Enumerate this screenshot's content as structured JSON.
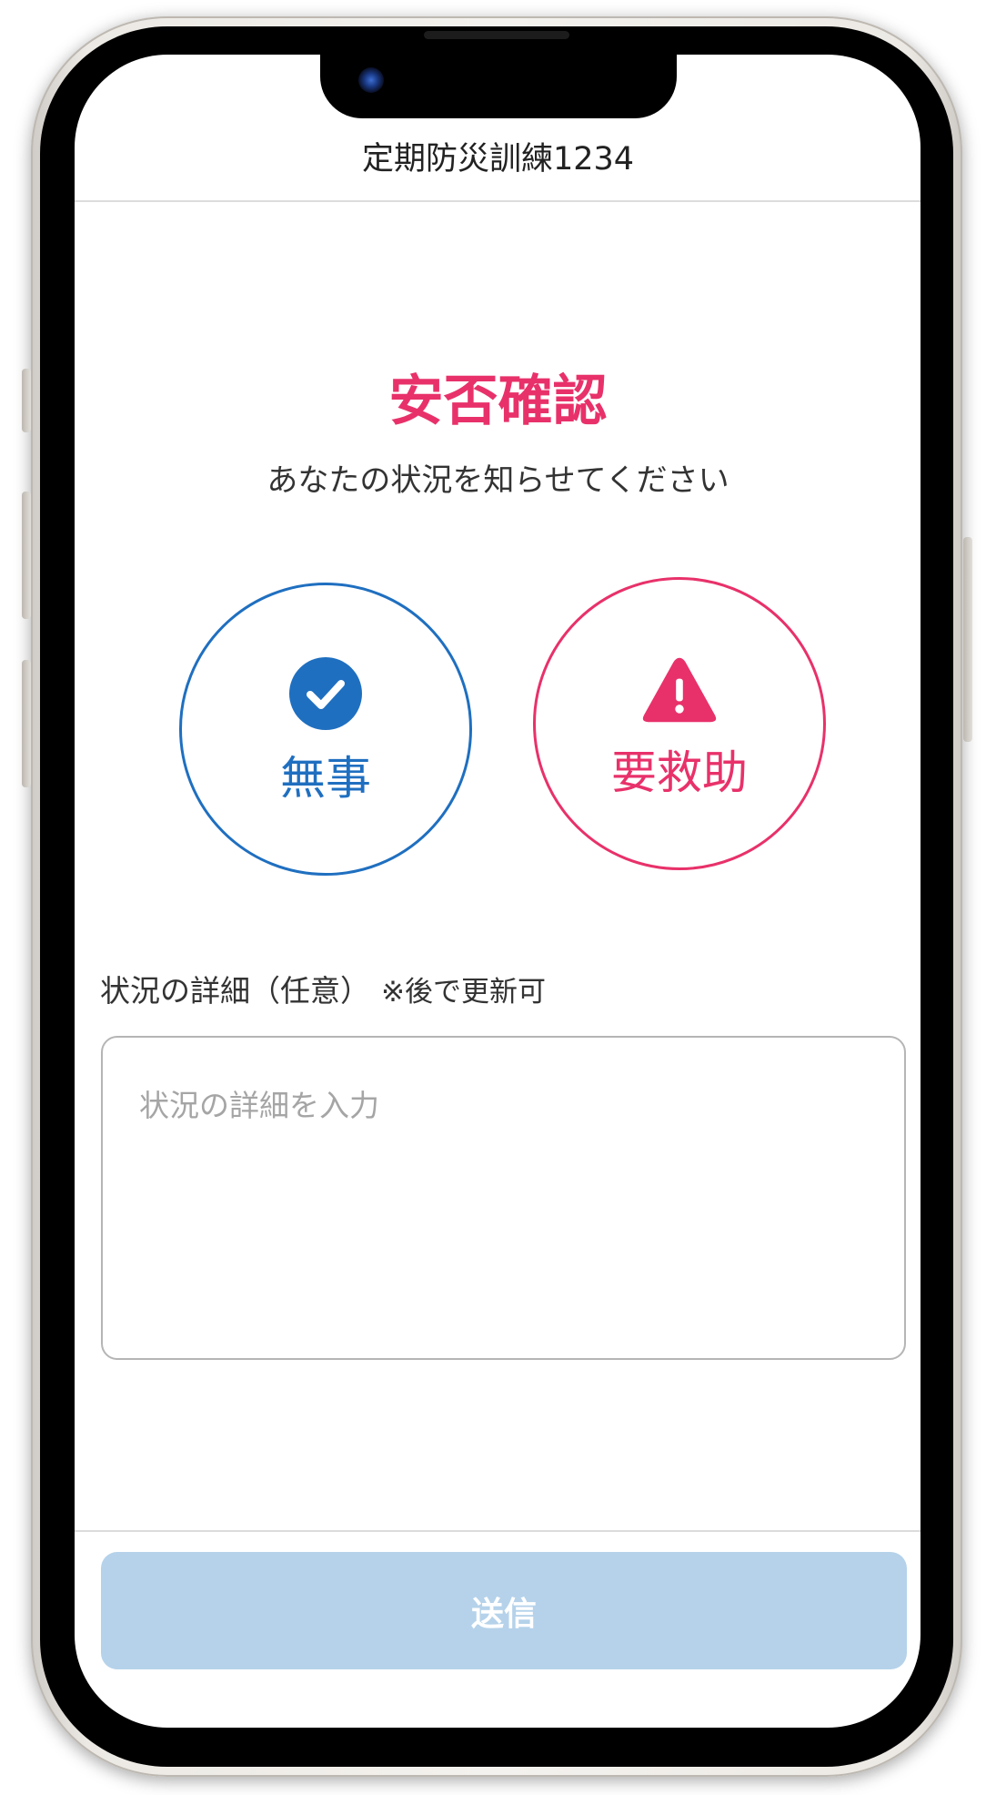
{
  "header": {
    "title": "定期防災訓練1234"
  },
  "main": {
    "title": "安否確認",
    "subtitle": "あなたの状況を知らせてください",
    "choices": {
      "safe": {
        "label": "無事",
        "icon": "check-circle-icon",
        "color": "#1f6fc0"
      },
      "rescue": {
        "label": "要救助",
        "icon": "warning-triangle-icon",
        "color": "#e8316a"
      }
    },
    "details": {
      "label": "状況の詳細（任意）",
      "note": "※後で更新可",
      "placeholder": "状況の詳細を入力",
      "value": ""
    }
  },
  "footer": {
    "submit_label": "送信",
    "submit_enabled": false
  },
  "colors": {
    "accent_pink": "#e8316a",
    "accent_blue": "#1f6fc0",
    "disabled_button": "#b5d2ea"
  }
}
